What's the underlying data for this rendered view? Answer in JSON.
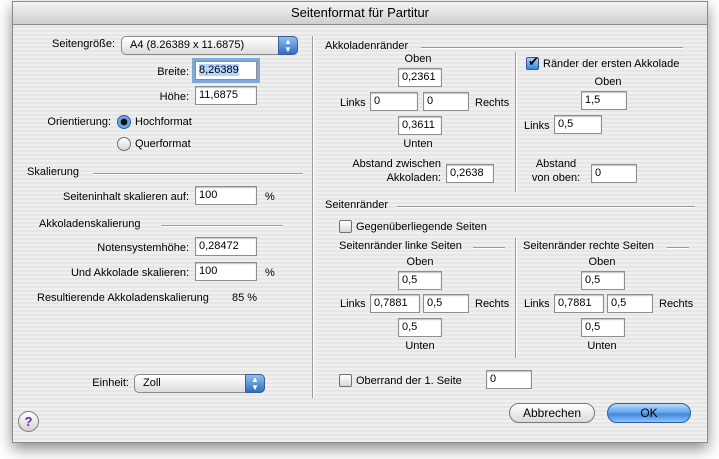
{
  "window": {
    "title": "Seitenformat für Partitur"
  },
  "left": {
    "page_size_label": "Seitengröße:",
    "page_size_value": "A4 (8.26389 x 11.6875)",
    "width_label": "Breite:",
    "width_value": "8,26389",
    "height_label": "Höhe:",
    "height_value": "11,6875",
    "orientation_label": "Orientierung:",
    "portrait_label": "Hochformat",
    "landscape_label": "Querformat",
    "orientation_selected": "Hochformat",
    "scaling_header": "Skalierung",
    "scale_content_label": "Seiteninhalt skalieren auf:",
    "scale_content_value": "100",
    "percent": "%",
    "system_scaling_header": "Akkoladenskalierung",
    "staff_height_label": "Notensystemhöhe:",
    "staff_height_value": "0,28472",
    "scale_system_label": "Und Akkolade skalieren:",
    "scale_system_value": "100",
    "resulting_label": "Resultierende Akkoladenskalierung",
    "resulting_value": "85 %",
    "unit_label": "Einheit:",
    "unit_value": "Zoll"
  },
  "system_margins": {
    "header": "Akkoladenränder",
    "top_label": "Oben",
    "top_value": "0,2361",
    "left_label": "Links",
    "left_value": "0",
    "right_value": "0",
    "right_label": "Rechts",
    "bottom_value": "0,3611",
    "bottom_label": "Unten",
    "spacing_label_1": "Abstand zwischen",
    "spacing_label_2": "Akkoladen:",
    "spacing_value": "0,2638"
  },
  "first_system": {
    "checkbox_label": "Ränder der ersten Akkolade",
    "checked": true,
    "top_label": "Oben",
    "top_value": "1,5",
    "left_label": "Links",
    "left_value": "0,5",
    "distance_label_1": "Abstand",
    "distance_label_2": "von oben:",
    "distance_value": "0"
  },
  "page_margins": {
    "header": "Seitenränder",
    "facing_pages_label": "Gegenüberliegende Seiten",
    "facing_checked": false,
    "left_pages": {
      "header": "Seitenränder linke Seiten",
      "top_label": "Oben",
      "top_value": "0,5",
      "left_label": "Links",
      "left_value": "0,7881",
      "right_value": "0,5",
      "right_label": "Rechts",
      "bottom_value": "0,5",
      "bottom_label": "Unten"
    },
    "right_pages": {
      "header": "Seitenränder rechte Seiten",
      "top_label": "Oben",
      "top_value": "0,5",
      "left_label": "Links",
      "left_value": "0,7881",
      "right_value": "0,5",
      "right_label": "Rechts",
      "bottom_value": "0,5",
      "bottom_label": "Unten"
    },
    "first_page_top_label": "Oberrand der 1. Seite",
    "first_page_top_checked": false,
    "first_page_top_value": "0"
  },
  "buttons": {
    "cancel": "Abbrechen",
    "ok": "OK",
    "help": "?"
  },
  "colors": {
    "accent": "#3c86de",
    "focus_ring": "#7ea9d9"
  }
}
